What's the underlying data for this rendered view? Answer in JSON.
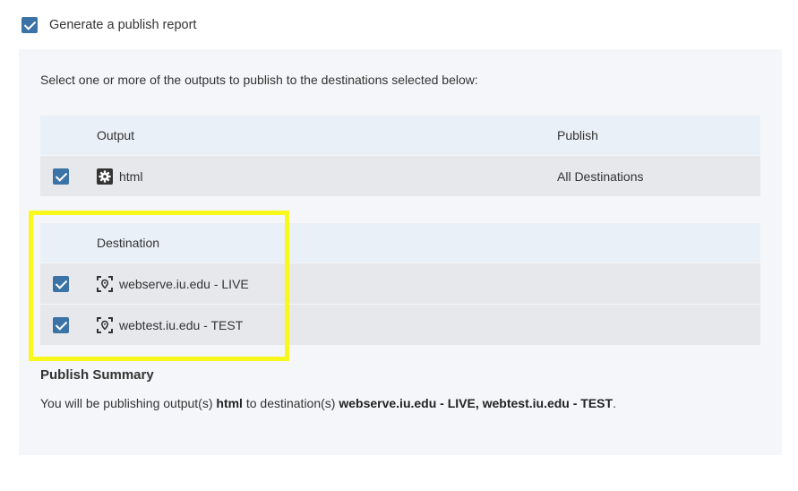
{
  "report": {
    "label": "Generate a publish report",
    "checked": true
  },
  "intro": "Select one or more of the outputs to publish to the destinations selected below:",
  "outputs_table": {
    "headers": {
      "output": "Output",
      "publish": "Publish"
    },
    "rows": [
      {
        "name": "html",
        "publish": "All Destinations",
        "icon": "gear-icon",
        "checked": true
      }
    ]
  },
  "destinations_table": {
    "header": "Destination",
    "rows": [
      {
        "name": "webserve.iu.edu - LIVE",
        "icon": "location-target-icon",
        "checked": true
      },
      {
        "name": "webtest.iu.edu - TEST",
        "icon": "location-target-icon",
        "checked": true
      }
    ]
  },
  "summary": {
    "title": "Publish Summary",
    "prefix": "You will be publishing output(s) ",
    "outputs": "html",
    "middle": " to destination(s) ",
    "destinations": "webserve.iu.edu - LIVE, webtest.iu.edu - TEST",
    "suffix": "."
  },
  "colors": {
    "accent": "#3b73a6",
    "highlight": "#f8f81c"
  }
}
